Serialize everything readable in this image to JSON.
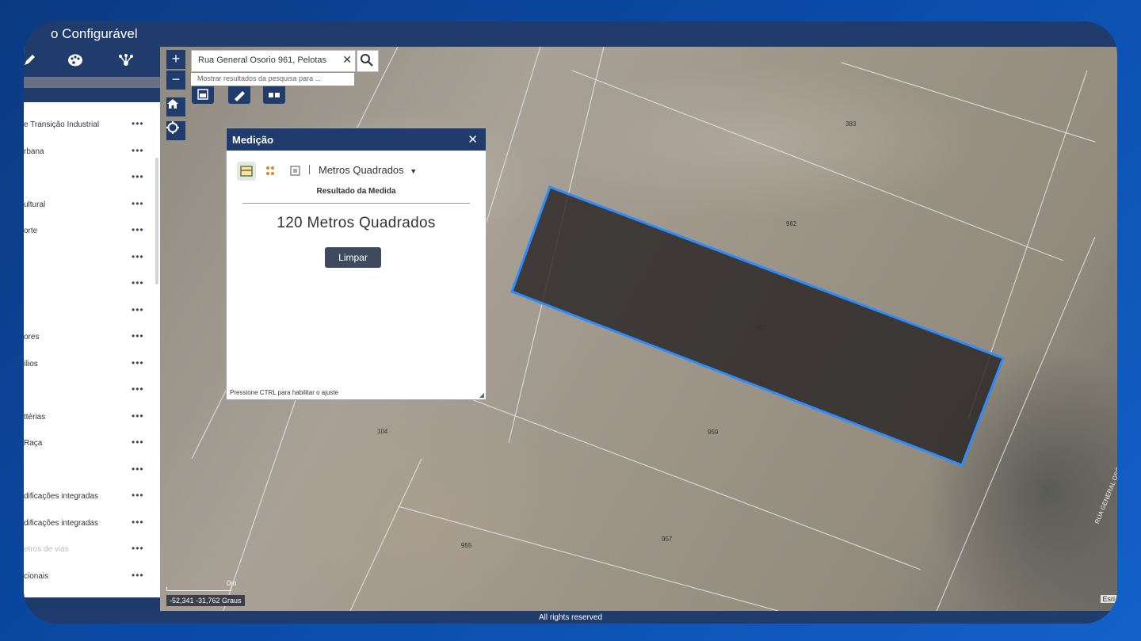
{
  "app": {
    "title": "o Configurável"
  },
  "sidebar": {
    "toolbar_icons": [
      "pencil-icon",
      "palette-icon",
      "network-icon"
    ],
    "items": [
      {
        "label": "e Transição Industrial",
        "faded": false
      },
      {
        "label": "rbana",
        "faded": false
      },
      {
        "label": "",
        "faded": false
      },
      {
        "label": "ultural",
        "faded": false
      },
      {
        "label": "orte",
        "faded": false
      },
      {
        "label": "",
        "faded": false
      },
      {
        "label": "",
        "faded": false
      },
      {
        "label": "",
        "faded": false
      },
      {
        "label": "ores",
        "faded": false
      },
      {
        "label": "ílios",
        "faded": false
      },
      {
        "label": "",
        "faded": false
      },
      {
        "label": "ttérias",
        "faded": false
      },
      {
        "label": "Raça",
        "faded": false
      },
      {
        "label": "",
        "faded": false
      },
      {
        "label": "dificações integradas",
        "faded": false
      },
      {
        "label": "dificações integradas",
        "faded": false
      },
      {
        "label": "etros de vias",
        "faded": true
      },
      {
        "label": "cionais",
        "faded": false
      }
    ],
    "more_label": "•••",
    "collapse_label": "◂◂"
  },
  "map": {
    "zoom_in": "+",
    "zoom_out": "−",
    "search": {
      "value": "Rua General Osorio 961, Pelotas",
      "clear": "✕",
      "hint": "Mostrar resultados da pesquisa para ..."
    },
    "plot_numbers": [
      "383",
      "962",
      "961",
      "959",
      "104",
      "955",
      "957"
    ],
    "scale_label": "0m",
    "coordinates": "-52,341 -31,762 Graus",
    "attribution_logo": "Esri",
    "road_label": "RUA GENERAL OSÓRIO",
    "copyright": "All rights reserved"
  },
  "medicao": {
    "title": "Medição",
    "close": "✕",
    "unit": "Metros Quadrados",
    "result_label": "Resultado da Medida",
    "result_value": "120 Metros Quadrados",
    "clear_button": "Limpar",
    "footer": "Pressione CTRL para habilitar o ajuste"
  },
  "colors": {
    "header": "#1f3c6c",
    "selection_outline": "#2a8cff",
    "button": "#3f4a5e"
  }
}
